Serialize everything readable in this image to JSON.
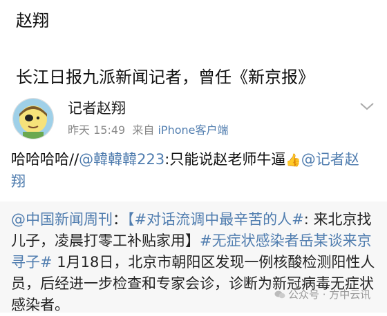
{
  "header": {
    "name": "赵翔",
    "description": "长江日报九派新闻记者，曾任《新京报》"
  },
  "post": {
    "user_name": "记者赵翔",
    "time": "昨天 15:49",
    "source_prefix": "来自",
    "device": "iPhone客户端",
    "text_start": "哈哈哈哈//",
    "mention1": "@韓韓韓223",
    "text_middle": ":只能说赵老师牛逼",
    "mention2": "@记者赵翔",
    "thumb_icon": "thumbs-up-emoji"
  },
  "repost": {
    "mention": "@中国新闻周刊",
    "colon": "：",
    "hashtag1": "【#对话流调中最辛苦的人#",
    "text1": ": 来北京找儿子，凌晨打零工补贴家用】",
    "hashtag2": "#无症状感染者岳某谈来京寻子#",
    "text2": " 1月18日，北京市朝阳区发现一例核酸检测阳性人员，后经进一步检查和专家会诊，诊断为新冠病毒无症状感染者。"
  },
  "watermark": {
    "text": "公众号 · 方中云讯",
    "icon": "wechat-icon"
  },
  "colors": {
    "link": "#507daf",
    "meta": "#888888",
    "repost_bg": "#f7f7f7"
  }
}
